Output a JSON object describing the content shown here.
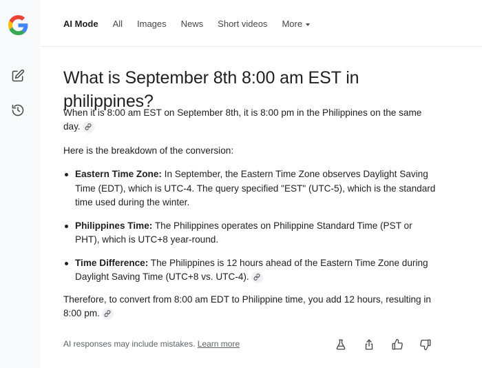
{
  "brand": {
    "logo_icon": "google-g-logo",
    "colors": {
      "blue": "#4285F4",
      "red": "#EA4335",
      "yellow": "#FBBC05",
      "green": "#34A853"
    }
  },
  "rail": {
    "new_chat_icon": "edit-icon",
    "history_icon": "history-icon"
  },
  "nav": {
    "tabs": [
      {
        "label": "AI Mode",
        "active": true
      },
      {
        "label": "All"
      },
      {
        "label": "Images"
      },
      {
        "label": "News"
      },
      {
        "label": "Short videos"
      },
      {
        "label": "More"
      }
    ]
  },
  "answer": {
    "question": "What is September 8th 8:00 am EST in philippines?",
    "intro": "When it is 8:00 am EST on September 8th, it is 8:00 pm in the Philippines on the same day.",
    "breakdown_intro": "Here is the breakdown of the conversion:",
    "bullets": [
      {
        "term": "Eastern Time Zone:",
        "text": " In September, the Eastern Time Zone observes Daylight Saving Time (EDT), which is UTC-4. The query specified \"EST\" (UTC-5), which is the standard time used during the winter."
      },
      {
        "term": "Philippines Time:",
        "text": " The Philippines operates on Philippine Standard Time (PST or PHT), which is UTC+8 year-round."
      },
      {
        "term": "Time Difference:",
        "text": " The Philippines is 12 hours ahead of the Eastern Time Zone during Daylight Saving Time (UTC+8 vs. UTC-4)."
      }
    ],
    "conclusion": "Therefore, to convert from 8:00 am EDT to Philippine time, you add 12 hours, resulting in 8:00 pm."
  },
  "footer": {
    "disclaimer": "AI responses may include mistakes.",
    "learn_more": "Learn more",
    "action_icons": [
      "flask-icon",
      "share-icon",
      "thumbs-up-icon",
      "thumbs-down-icon"
    ]
  }
}
